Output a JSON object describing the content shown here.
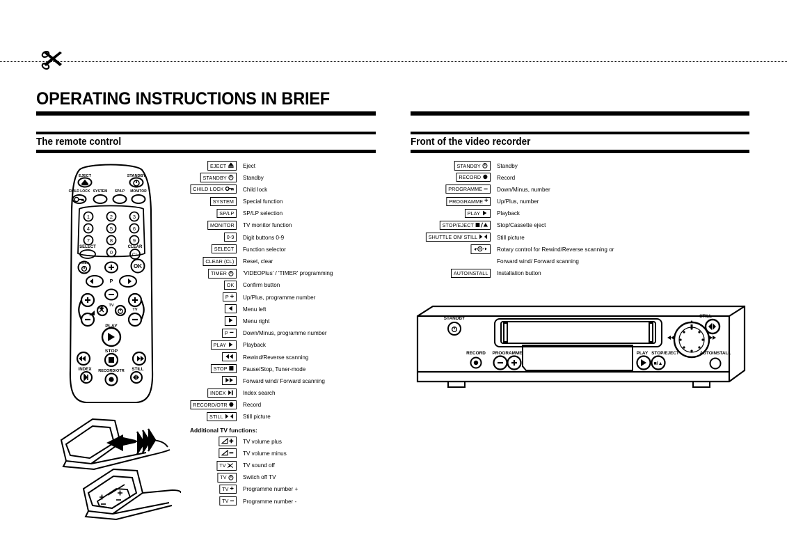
{
  "page": {
    "main_title": "OPERATING INSTRUCTIONS IN BRIEF",
    "cut_icon": "scissors-icon"
  },
  "left_column": {
    "section_title": "The remote control",
    "legend": [
      {
        "key": "EJECT",
        "glyph": "eject-triangle",
        "desc": "Eject"
      },
      {
        "key": "STANDBY",
        "glyph": "power-standby",
        "desc": "Standby"
      },
      {
        "key": "CHILD LOCK",
        "glyph": "key-lock",
        "desc": "Child lock"
      },
      {
        "key": "SYSTEM",
        "glyph": "",
        "desc": "Special function"
      },
      {
        "key": "SP/LP",
        "glyph": "",
        "desc": "SP/LP selection"
      },
      {
        "key": "MONITOR",
        "glyph": "",
        "desc": "TV monitor function"
      },
      {
        "key": "0-9",
        "glyph": "",
        "desc": "Digit buttons 0-9"
      },
      {
        "key": "SELECT",
        "glyph": "",
        "desc": "Function selector"
      },
      {
        "key": "CLEAR (CL)",
        "glyph": "",
        "desc": "Reset, clear"
      },
      {
        "key": "TIMER",
        "glyph": "clock-icon",
        "desc": "'VIDEOPlus' / 'TIMER' programming"
      },
      {
        "key": "OK",
        "glyph": "",
        "desc": "Confirm button"
      },
      {
        "key": "P",
        "glyph": "plus",
        "desc": "Up/Plus, programme number"
      },
      {
        "key": "",
        "glyph": "triangle-left",
        "desc": "Menu left"
      },
      {
        "key": "",
        "glyph": "triangle-right",
        "desc": "Menu right"
      },
      {
        "key": "P",
        "glyph": "minus",
        "desc": "Down/Minus, programme number"
      },
      {
        "key": "PLAY",
        "glyph": "triangle-right",
        "desc": "Playback"
      },
      {
        "key": "",
        "glyph": "rewind-double",
        "desc": "Rewind/Reverse scanning"
      },
      {
        "key": "STOP",
        "glyph": "square-stop",
        "desc": "Pause/Stop, Tuner-mode"
      },
      {
        "key": "",
        "glyph": "forward-double",
        "desc": "Forward wind/ Forward scanning"
      },
      {
        "key": "INDEX",
        "glyph": "skip-next",
        "desc": "Index search"
      },
      {
        "key": "RECORD/OTR",
        "glyph": "record-dot",
        "desc": "Record"
      },
      {
        "key": "STILL",
        "glyph": "still-frame",
        "desc": "Still picture"
      }
    ],
    "additional_heading": "Additional TV functions:",
    "additional_legend": [
      {
        "key": "",
        "glyph": "volume-wedge-plus",
        "desc": "TV volume plus"
      },
      {
        "key": "",
        "glyph": "volume-wedge-minus",
        "desc": "TV volume minus"
      },
      {
        "key": "TV",
        "glyph": "mute-speaker",
        "desc": "TV sound off"
      },
      {
        "key": "TV",
        "glyph": "power-standby",
        "desc": "Switch off TV"
      },
      {
        "key": "TV",
        "glyph": "plus",
        "desc": "Programme number +"
      },
      {
        "key": "TV",
        "glyph": "minus",
        "desc": "Programme number -"
      }
    ],
    "remote_illustration": {
      "name": "remote-control-diagram",
      "labels": {
        "eject": "EJECT",
        "standby": "STANDBY",
        "child_lock": "CHILD LOCK",
        "system": "SYSTEM",
        "splp": "SP/LP",
        "monitor": "MONITOR",
        "select": "SELECT",
        "clear": "CLEAR",
        "cl": "CL",
        "timer": "TIMER",
        "ok": "OK",
        "p": "P",
        "tv": "TV",
        "play": "PLAY",
        "stop": "STOP",
        "index": "INDEX",
        "still": "STILL",
        "record_otr": "RECORD/OTR"
      },
      "digits": [
        "1",
        "2",
        "3",
        "4",
        "5",
        "6",
        "7",
        "8",
        "9",
        "0"
      ]
    },
    "battery_illustration": {
      "name": "battery-compartment-diagram",
      "polarity": [
        "+",
        "-",
        "+",
        "-"
      ]
    }
  },
  "right_column": {
    "section_title": "Front of the video recorder",
    "legend": [
      {
        "key": "STANDBY",
        "glyph": "power-standby",
        "desc": "Standby"
      },
      {
        "key": "RECORD",
        "glyph": "record-dot",
        "desc": "Record"
      },
      {
        "key": "PROGRAMME",
        "glyph": "minus",
        "desc": "Down/Minus, number"
      },
      {
        "key": "PROGRAMME",
        "glyph": "plus",
        "desc": "Up/Plus, number"
      },
      {
        "key": "PLAY",
        "glyph": "triangle-right",
        "desc": "Playback"
      },
      {
        "key": "STOP/EJECT",
        "glyph": "stop-slash-eject",
        "desc": "Stop/Cassette eject"
      },
      {
        "key": "SHUTTLE ON/ STILL",
        "glyph": "still-frame",
        "desc": "Still picture"
      },
      {
        "key": "",
        "glyph": "rotary-dial",
        "desc": "Rotary control for Rewind/Reverse scanning or"
      },
      {
        "key": "",
        "glyph": "",
        "desc": "Forward wind/ Forward scanning",
        "continuation": true
      },
      {
        "key": "AUTOINSTALL",
        "glyph": "",
        "desc": "Installation button"
      }
    ],
    "vcr_illustration": {
      "name": "vcr-front-panel-diagram",
      "labels": {
        "standby": "STANDBY",
        "record": "RECORD",
        "programme": "PROGRAMME",
        "play": "PLAY",
        "stop_eject": "STOP/EJECT",
        "still": "STILL",
        "autoinstall": "AUTOINSTALL"
      },
      "button_glyphs": {
        "play": "▶",
        "stop_eject": "■/▲",
        "minus": "−",
        "plus": "+"
      }
    }
  },
  "colors": {
    "ink": "#000000",
    "paper": "#ffffff"
  }
}
